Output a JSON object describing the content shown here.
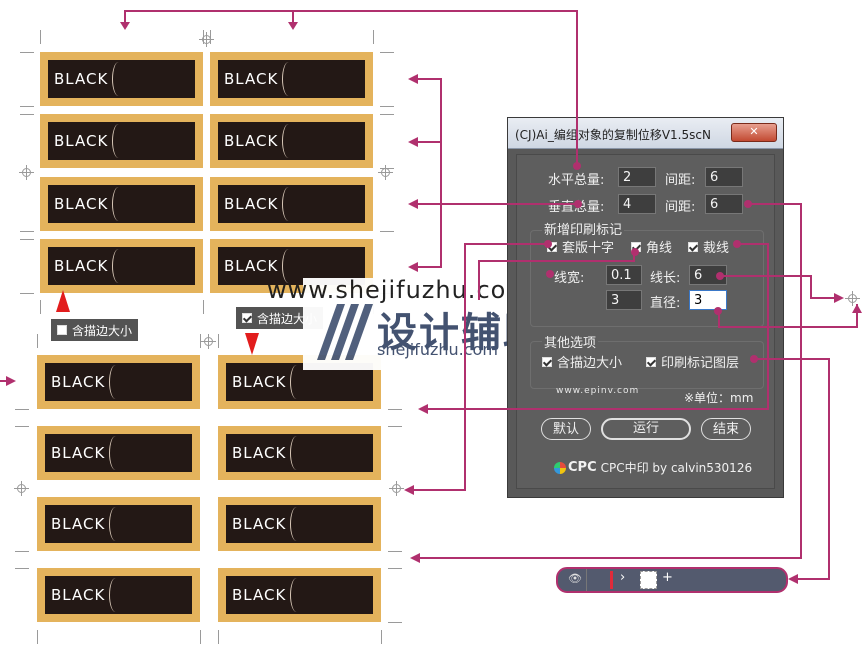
{
  "label_text": "BLACK",
  "checkbox_tags": {
    "left": {
      "label": "含描边大小",
      "checked": false
    },
    "right": {
      "label": "含描边大小",
      "checked": true
    }
  },
  "dialog": {
    "title": "(CJ)Ai_编组对象的复制位移V1.5scN",
    "close": "✕",
    "h_total_label": "水平总量:",
    "h_total_value": "2",
    "h_gap_label": "间距:",
    "h_gap_value": "6",
    "v_total_label": "垂直总量:",
    "v_total_value": "4",
    "v_gap_label": "间距:",
    "v_gap_value": "6",
    "marks_group_title": "新增印刷标记",
    "mark_cross": "套版十字",
    "mark_corner": "角线",
    "mark_trim": "裁线",
    "line_width_label": "线宽:",
    "line_width_value": "0.1",
    "line_length_label": "线长:",
    "line_length_value": "6",
    "offset_value": "3",
    "diameter_label": "直径:",
    "diameter_value": "3",
    "other_group_title": "其他选项",
    "opt_stroke": "含描边大小",
    "opt_layer": "印刷标记图层",
    "site": "www.epinv.com",
    "unit": "※单位：mm",
    "btn_default": "默认",
    "btn_run": "运行",
    "btn_end": "结束",
    "footer_logo": "CPC",
    "footer_text": "CPC中印 by calvin530126"
  },
  "watermark": {
    "top_text": "www.shejifuzhu.com",
    "brand": "设计辅助",
    "sub": "shejifuzhu.com"
  },
  "layers_panel": {
    "eye_icon": "eye-icon",
    "chevron": "›",
    "plus": "+"
  },
  "colors": {
    "accent": "#b0306e",
    "label_gold": "#e4b35c",
    "label_dark": "#231815",
    "dialog_bg": "#595959"
  }
}
